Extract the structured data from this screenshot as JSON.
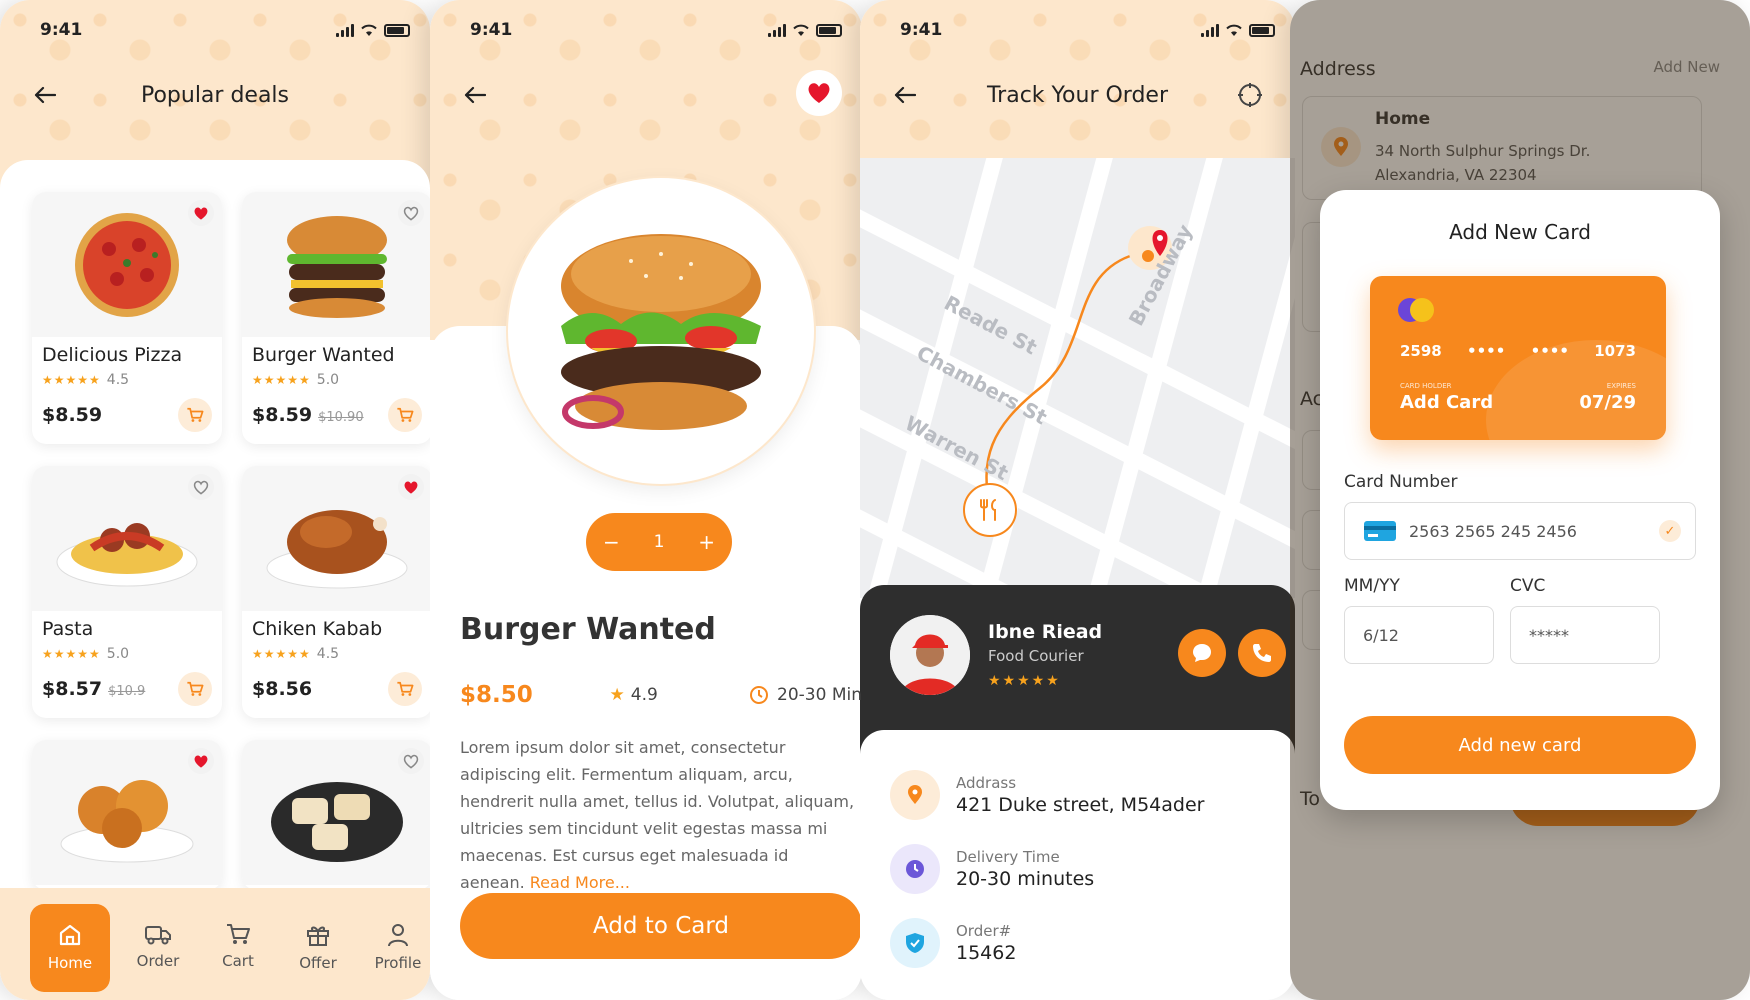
{
  "status": {
    "time": "9:41"
  },
  "screen1": {
    "title": "Popular deals",
    "items": [
      {
        "name": "Delicious Pizza",
        "stars": "★★★★★",
        "rating": "4.5",
        "price": "$8.59",
        "old": "",
        "fav": true,
        "icon": "pizza-image"
      },
      {
        "name": "Burger Wanted",
        "stars": "★★★★★",
        "rating": "5.0",
        "price": "$8.59",
        "old": "$10.90",
        "fav": false,
        "icon": "burger-image"
      },
      {
        "name": "Pasta",
        "stars": "★★★★★",
        "rating": "5.0",
        "price": "$8.57",
        "old": "$10.9",
        "fav": false,
        "icon": "pasta-image"
      },
      {
        "name": "Chiken Kabab",
        "stars": "★★★★★",
        "rating": "4.5",
        "price": "$8.56",
        "old": "",
        "fav": true,
        "icon": "chicken-image"
      },
      {
        "fav": true,
        "icon": "fried-chicken-image"
      },
      {
        "fav": false,
        "icon": "wraps-image"
      }
    ],
    "nav": {
      "home": "Home",
      "order": "Order",
      "cart": "Cart",
      "offer": "Offer",
      "profile": "Profile"
    }
  },
  "screen2": {
    "quantity": "1",
    "minus": "−",
    "plus": "+",
    "title": "Burger Wanted",
    "price": "$8.50",
    "rating": "4.9",
    "time": "20-30 Min",
    "description": "Lorem ipsum dolor sit amet, consectetur adipiscing elit. Fermentum aliquam, arcu, hendrerit nulla amet, tellus id. Volutpat, aliquam, ultricies sem tincidunt velit egestas massa mi maecenas. Est cursus eget malesuada id aenean.",
    "read_more": "Read More...",
    "cta": "Add to Card"
  },
  "screen3": {
    "title": "Track Your Order",
    "streets": [
      "Reade St",
      "Chambers St",
      "Warren St",
      "Broadway"
    ],
    "courier": {
      "name": "Ibne Riead",
      "role": "Food Courier",
      "stars": "★★★★★"
    },
    "info": [
      {
        "label": "Addrass",
        "value": "421 Duke street, M54ader",
        "color": "#f7881d",
        "bg": "#fdecd8",
        "icon": "location-pin-icon"
      },
      {
        "label": "Delivery Time",
        "value": "20-30 minutes",
        "color": "#6b57d8",
        "bg": "#ebe7fb",
        "icon": "clock-icon"
      },
      {
        "label": "Order#",
        "value": "15462",
        "color": "#1fa5e0",
        "bg": "#e0f3fc",
        "icon": "shield-check-icon"
      }
    ]
  },
  "screen4": {
    "header": "Address",
    "add_new": "Add New",
    "address_title": "Home",
    "address_line1": "34 North Sulphur Springs Dr.",
    "address_line2": "Alexandria, VA 22304",
    "peek_a": "Ac",
    "peek_b": "To",
    "modal": {
      "title": "Add New Card",
      "card": {
        "g1": "2598",
        "g2": "••••",
        "g3": "••••",
        "g4": "1073",
        "holder_label": "CARD HOLDER",
        "holder": "Add Card",
        "expires_label": "EXPIRES",
        "expires": "07/29"
      },
      "card_number_label": "Card Number",
      "card_number": "2563 2565 245 2456",
      "mmyy_label": "MM/YY",
      "mmyy": "6/12",
      "cvc_label": "CVC",
      "cvc": "*****",
      "button": "Add new card"
    }
  },
  "colors": {
    "accent": "#f7881d",
    "cream": "#fde7cc",
    "dark": "#2e2e2e"
  }
}
